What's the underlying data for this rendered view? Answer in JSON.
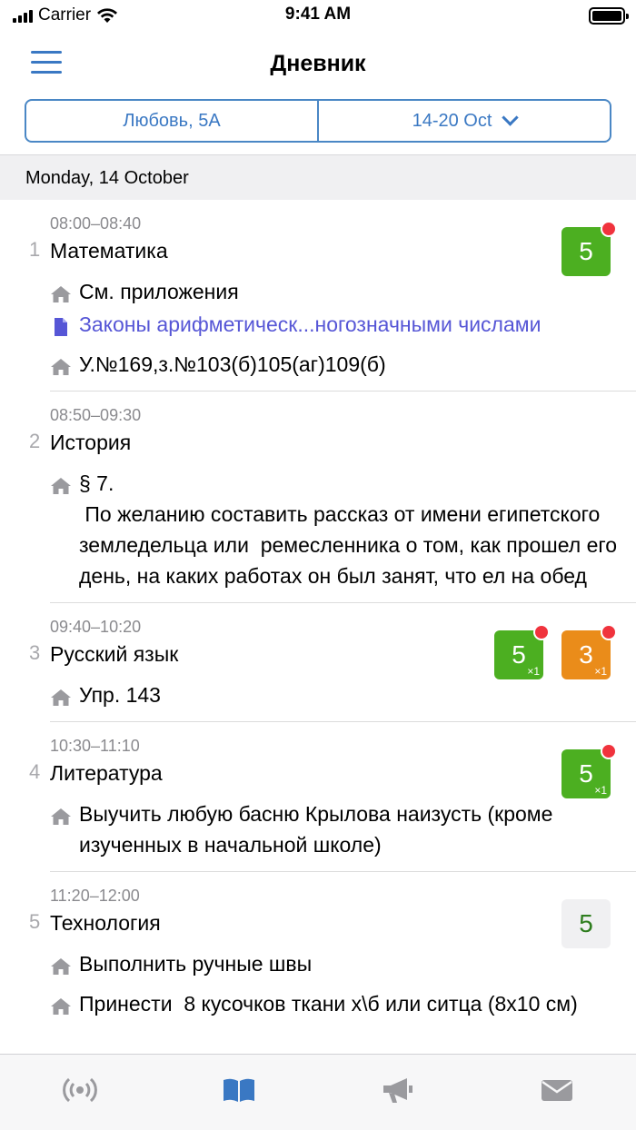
{
  "status_bar": {
    "carrier": "Carrier",
    "time": "9:41 AM"
  },
  "nav": {
    "title": "Дневник",
    "menu_icon": "hamburger-menu-icon"
  },
  "segment": {
    "student": "Любовь, 5А",
    "week": "14-20 Oct"
  },
  "day": {
    "header": "Monday, 14 October"
  },
  "lessons": [
    {
      "num": "1",
      "time": "08:00–08:40",
      "name": "Математика",
      "grades": [
        {
          "value": "5",
          "mult": "",
          "color": "green",
          "new": true
        }
      ],
      "homework": [
        {
          "type": "home",
          "text": "См. приложения"
        },
        {
          "type": "file",
          "text": "Законы арифметическ...ногозначными числами"
        },
        {
          "type": "home",
          "text": "У.№169,з.№103(б)105(аг)109(б)"
        }
      ]
    },
    {
      "num": "2",
      "time": "08:50–09:30",
      "name": "История",
      "grades": [],
      "homework": [
        {
          "type": "home",
          "text": "§ 7.\n По желанию составить рассказ от имени египетского земледельца или  ремесленника о том, как прошел его день, на каких работах он был занят, что ел на обед"
        }
      ]
    },
    {
      "num": "3",
      "time": "09:40–10:20",
      "name": "Русский язык",
      "grades": [
        {
          "value": "5",
          "mult": "×1",
          "color": "green",
          "new": true
        },
        {
          "value": "3",
          "mult": "×1",
          "color": "orange",
          "new": true
        }
      ],
      "homework": [
        {
          "type": "home",
          "text": "Упр. 143"
        }
      ]
    },
    {
      "num": "4",
      "time": "10:30–11:10",
      "name": "Литература",
      "grades": [
        {
          "value": "5",
          "mult": "×1",
          "color": "green",
          "new": true
        }
      ],
      "homework": [
        {
          "type": "home",
          "text": "Выучить любую басню Крылова наизусть (кроме изученных в начальной школе)"
        }
      ]
    },
    {
      "num": "5",
      "time": "11:20–12:00",
      "name": "Технология",
      "grades": [
        {
          "value": "5",
          "mult": "",
          "color": "plain",
          "new": false
        }
      ],
      "homework": [
        {
          "type": "home",
          "text": "Выполнить ручные швы"
        },
        {
          "type": "home",
          "text": "Принести  8 кусочков ткани х\\б или ситца (8x10 см)"
        }
      ]
    }
  ],
  "tabbar": {
    "tabs": [
      {
        "icon": "broadcast-icon",
        "active": false
      },
      {
        "icon": "book-icon",
        "active": true
      },
      {
        "icon": "megaphone-icon",
        "active": false
      },
      {
        "icon": "envelope-icon",
        "active": false
      }
    ]
  },
  "colors": {
    "accent": "#3a78c3",
    "grade_green": "#4caf21",
    "grade_orange": "#ea8c1a",
    "badge_red": "#f0333d",
    "link": "#5656d6"
  }
}
